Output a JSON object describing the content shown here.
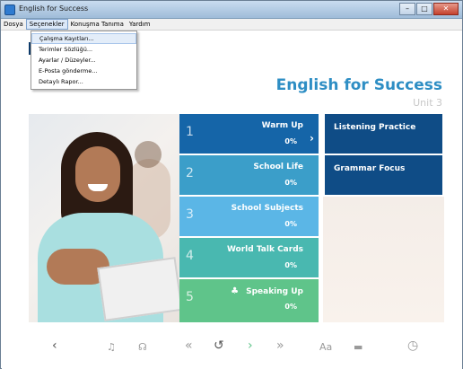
{
  "window": {
    "title": "English for Success",
    "controls": [
      "–",
      "□",
      "✕"
    ]
  },
  "menubar": {
    "items": [
      "Dosya",
      "Seçenekler",
      "Konuşma Tanıma",
      "Yardım"
    ]
  },
  "dropdown": {
    "items": [
      "Çalışma Kayıtları...",
      "Terimler Sözlüğü...",
      "Ayarlar / Düzeyler...",
      "E-Posta gönderme...",
      "Detaylı Rapor..."
    ]
  },
  "header": {
    "course_title": "English for Success",
    "unit": "Unit 3"
  },
  "tiles": [
    {
      "num": "1",
      "name": "Warm Up",
      "pct": "0%"
    },
    {
      "num": "2",
      "name": "School Life",
      "pct": "0%"
    },
    {
      "num": "3",
      "name": "School Subjects",
      "pct": "0%"
    },
    {
      "num": "4",
      "name": "World Talk Cards",
      "pct": "0%"
    },
    {
      "num": "5",
      "name": "Speaking Up",
      "pct": "0%"
    }
  ],
  "side_tiles": [
    {
      "name": "Listening Practice"
    },
    {
      "name": "Grammar Focus"
    }
  ],
  "icons": {
    "tile_chevron": "›",
    "speaking_icon": "♣"
  },
  "toolbar": {
    "back": "‹",
    "mic": "♫",
    "headset": "☊",
    "rewind": "«",
    "replay": "↺",
    "next": "›",
    "forward": "»",
    "font_size": "Aa",
    "keyboard": "▬",
    "timer": "◷"
  },
  "colors": {
    "tile1": "#1565a8",
    "tile2": "#3b9ec9",
    "tile3": "#5bb6e6",
    "tile4": "#49b8b0",
    "tile5": "#5fc48a",
    "side": "#0f4c86",
    "title": "#2e8ec4"
  }
}
